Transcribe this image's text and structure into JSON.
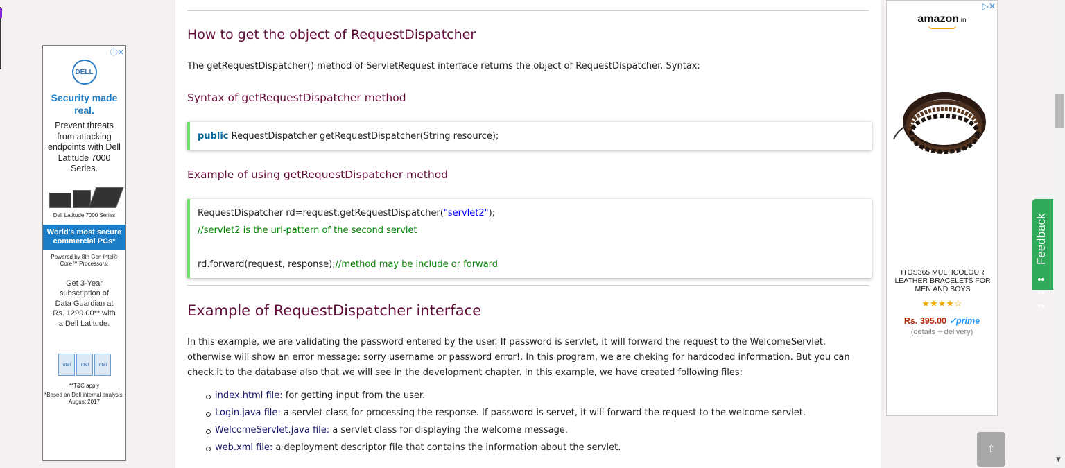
{
  "left_ad": {
    "brand": "DELL",
    "headline": "Security made real.",
    "body": "Prevent threats from attacking endpoints with Dell Latitude 7000 Series.",
    "laptop_caption": "Dell Latitude 7000 Series",
    "banner": "World's most secure commercial PCs*",
    "powered_by": "Powered by 8th Gen Intel® Core™ Processors.",
    "offer": "Get 3-Year subscription of Data Guardian at Rs. 1299.00** with a Dell Latitude.",
    "intel_badge": "intel",
    "tc": "**T&C apply",
    "based": "*Based on Dell internal analysis, August 2017"
  },
  "main": {
    "heading_get_object": "How to get the object of RequestDispatcher",
    "intro_text": "The getRequestDispatcher() method of ServletRequest interface returns the object of RequestDispatcher. Syntax:",
    "syntax_heading": "Syntax of getRequestDispatcher method",
    "syntax_code": {
      "keyword": "public",
      "rest": " RequestDispatcher getRequestDispatcher(String resource);"
    },
    "example_usage_heading": "Example of using getRequestDispatcher method",
    "example_code": {
      "line1_a": "RequestDispatcher rd=request.getRequestDispatcher(",
      "line1_str": "\"servlet2\"",
      "line1_b": ");",
      "line2_comment": "//servlet2 is the url-pattern of the second servlet",
      "line3_a": "rd.forward(request, response);",
      "line3_comment": "//method may be include or forward"
    },
    "example_interface_heading": "Example of RequestDispatcher interface",
    "paragraph_line1": "In this example, we are validating the password entered by the user. If password is servlet, it will forward the request to the WelcomeServlet,",
    "paragraph_line2": "otherwise will show an error message: sorry username or password error!. In this program, we are cheking for hardcoded information. But you can",
    "paragraph_line3": "check it to the database also that we will see in the development chapter. In this example, we have created following files:",
    "files": [
      {
        "term": "index.html file:",
        "desc": " for getting input from the user."
      },
      {
        "term": "Login.java file:",
        "desc": " a servlet class for processing the response. If password is servet, it will forward the request to the welcome servlet."
      },
      {
        "term": "WelcomeServlet.java file:",
        "desc": " a servlet class for displaying the welcome message."
      },
      {
        "term": "web.xml file:",
        "desc": " a deployment descriptor file that contains the information about the servlet."
      }
    ]
  },
  "right_ad": {
    "logo": "amazon",
    "logo_suffix": ".in",
    "product_name": "ITOS365 MULTICOLOUR LEATHER BRACELETS FOR MEN AND BOYS",
    "stars": "★★★★☆",
    "rating": 3.5,
    "price": "Rs. 395.00",
    "prime": "✓prime",
    "details": "(details + delivery)"
  },
  "feedback": {
    "label": "Feedback"
  },
  "back_to_top": {
    "label": "⇧"
  },
  "icons": {
    "ad_info": "ⓘ",
    "ad_close": "✕",
    "ad_play": "▷",
    "scroll_down": "▼"
  }
}
